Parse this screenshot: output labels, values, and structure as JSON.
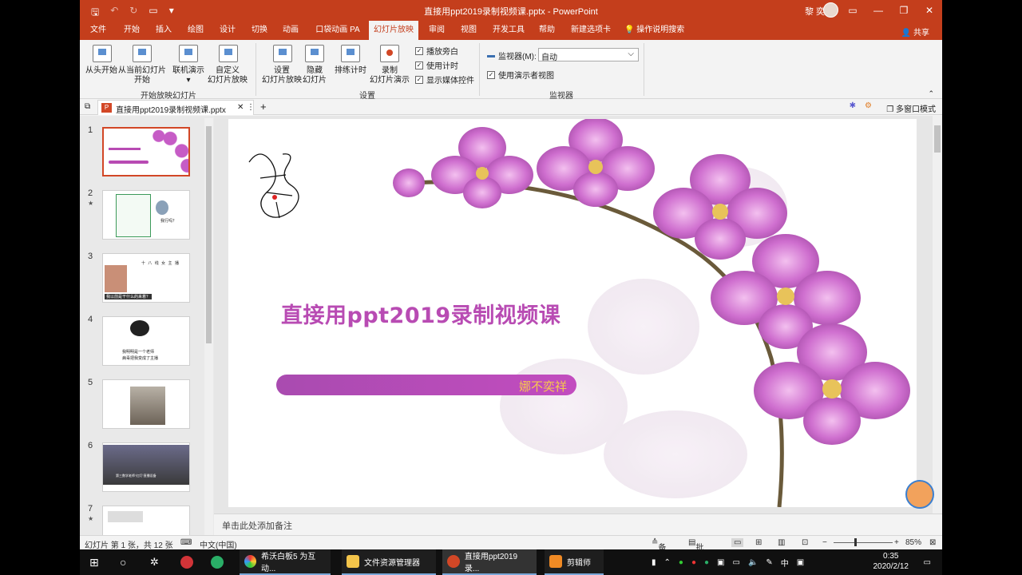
{
  "window": {
    "title": "直接用ppt2019录制视频课.pptx  -  PowerPoint",
    "user": "黎 奕娜"
  },
  "tabs": [
    "文件",
    "开始",
    "插入",
    "绘图",
    "设计",
    "切换",
    "动画",
    "口袋动画 PA",
    "幻灯片放映",
    "审阅",
    "视图",
    "开发工具",
    "帮助",
    "新建选项卡",
    "操作说明搜索"
  ],
  "active_tab": "幻灯片放映",
  "share_label": "共享",
  "ribbon": {
    "group1": {
      "label": "开始放映幻灯片",
      "from_start": "从头开始",
      "from_current_1": "从当前幻灯片",
      "from_current_2": "开始",
      "online": "联机演示",
      "custom_1": "自定义",
      "custom_2": "幻灯片放映"
    },
    "group2": {
      "label": "设置",
      "setup_1": "设置",
      "setup_2": "幻灯片放映",
      "hide_1": "隐藏",
      "hide_2": "幻灯片",
      "rehearse": "排练计时",
      "record_1": "录制",
      "record_2": "幻灯片演示",
      "chk_narration": "播放旁白",
      "chk_timings": "使用计时",
      "chk_media": "显示媒体控件"
    },
    "group3": {
      "label": "监视器",
      "monitor_label": "监视器(M):",
      "monitor_value": "自动",
      "presenter_view": "使用演示者视图"
    }
  },
  "doc_tab": {
    "name": "直接用ppt2019录制视频课.pptx",
    "multi_window": "多窗口模式"
  },
  "thumbnails": [
    {
      "num": "1",
      "star": ""
    },
    {
      "num": "2",
      "star": "★"
    },
    {
      "num": "3",
      "star": ""
    },
    {
      "num": "4",
      "star": ""
    },
    {
      "num": "5",
      "star": ""
    },
    {
      "num": "6",
      "star": ""
    },
    {
      "num": "7",
      "star": "★"
    }
  ],
  "thumb_texts": {
    "t3_head": "十 八 线 女 主 播",
    "t3_foot": "我以前是干什么的来着？",
    "t4_line1": "我明明是一个老师",
    "t4_line2": "病毒把我变成了主播",
    "t6_caption": "第三数学老师“红灯”直播设备",
    "t2_bubble": "我行吗？"
  },
  "slide": {
    "title": "直接用ppt2019录制视频课",
    "author": "娜不奕祥"
  },
  "notes_placeholder": "单击此处添加备注",
  "status": {
    "slide_info": "幻灯片 第 1 张，共 12 张",
    "language": "中文(中国)",
    "notes": "备注",
    "comments": "批注",
    "zoom": "85%"
  },
  "taskbar": {
    "app1": "希沃白板5 为互动...",
    "app2": "文件资源管理器",
    "app3": "直接用ppt2019录...",
    "app4": "剪辑师",
    "ime": "中",
    "time": "0:35",
    "date": "2020/2/12"
  },
  "colors": {
    "accent": "#c43e1c",
    "title_text": "#b84bb3",
    "pill": "#b14cb6",
    "author_text": "#f6c84c"
  }
}
